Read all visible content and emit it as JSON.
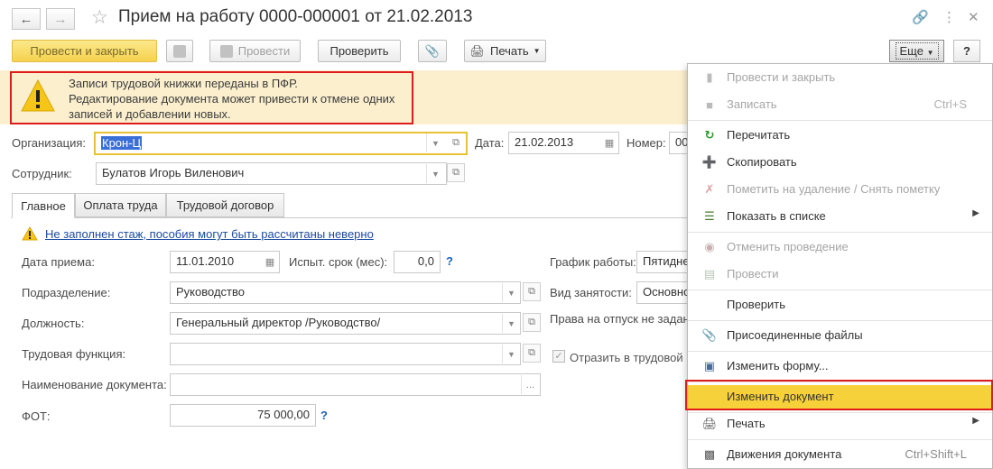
{
  "title": "Прием на работу 0000-000001 от 21.02.2013",
  "toolbar": {
    "post_close": "Провести и закрыть",
    "post": "Провести",
    "check": "Проверить",
    "print": "Печать",
    "more": "Еще",
    "help": "?"
  },
  "warning": {
    "line1": "Записи трудовой книжки переданы в ПФР.",
    "line2": "Редактирование документа может привести к отмене одних",
    "line3": "записей и добавлении новых."
  },
  "header": {
    "org_label": "Организация:",
    "org_value": "Крон-Ц",
    "date_label": "Дата:",
    "date_value": "21.02.2013",
    "number_label": "Номер:",
    "number_value": "00",
    "employee_label": "Сотрудник:",
    "employee_value": "Булатов Игорь Виленович"
  },
  "tabs": [
    "Главное",
    "Оплата труда",
    "Трудовой договор"
  ],
  "main": {
    "warning_link": "Не заполнен стаж, пособия могут быть рассчитаны неверно",
    "hire_date_label": "Дата приема:",
    "hire_date_value": "11.01.2010",
    "probation_label": "Испыт. срок (мес):",
    "probation_value": "0,0",
    "schedule_label": "График работы:",
    "schedule_value": "Пятидне",
    "department_label": "Подразделение:",
    "department_value": "Руководство",
    "employment_label": "Вид занятости:",
    "employment_value": "Основно",
    "position_label": "Должность:",
    "position_value": "Генеральный директор /Руководство/",
    "vacation_text": "Права на отпуск не задан",
    "function_label": "Трудовая функция:",
    "function_value": "",
    "reflect_label": "Отразить в трудовой",
    "docname_label": "Наименование документа:",
    "docname_value": "",
    "fot_label": "ФОТ:",
    "fot_value": "75 000,00"
  },
  "menu": {
    "items": [
      {
        "label": "Провести и закрыть",
        "shortcut": "",
        "icon": "post-close-icon",
        "disabled": true
      },
      {
        "label": "Записать",
        "shortcut": "Ctrl+S",
        "icon": "save-icon",
        "disabled": true
      },
      {
        "label": "Перечитать",
        "shortcut": "",
        "icon": "refresh-icon",
        "disabled": false
      },
      {
        "label": "Скопировать",
        "shortcut": "",
        "icon": "copy-icon",
        "disabled": false
      },
      {
        "label": "Пометить на удаление / Снять пометку",
        "shortcut": "",
        "icon": "mark-delete-icon",
        "disabled": true
      },
      {
        "label": "Показать в списке",
        "shortcut": "",
        "icon": "list-icon",
        "disabled": false
      },
      {
        "label": "Отменить проведение",
        "shortcut": "",
        "icon": "unpost-icon",
        "disabled": true
      },
      {
        "label": "Провести",
        "shortcut": "",
        "icon": "post-icon",
        "disabled": true
      },
      {
        "label": "Проверить",
        "shortcut": "",
        "icon": "",
        "disabled": false
      },
      {
        "label": "Присоединенные файлы",
        "shortcut": "",
        "icon": "paperclip-icon",
        "disabled": false
      },
      {
        "label": "Изменить форму...",
        "shortcut": "",
        "icon": "form-settings-icon",
        "disabled": false
      },
      {
        "label": "Изменить документ",
        "shortcut": "",
        "icon": "",
        "disabled": false
      },
      {
        "label": "Печать",
        "shortcut": "",
        "icon": "print-icon",
        "disabled": false
      },
      {
        "label": "Движения документа",
        "shortcut": "Ctrl+Shift+L",
        "icon": "movements-icon",
        "disabled": false
      }
    ]
  },
  "colors": {
    "primary_button": "#f5d24e",
    "warning_bg": "#fbefcd",
    "highlight": "#f7d13a",
    "red_frame": "#e01b1b",
    "link": "#1b4aa0"
  }
}
